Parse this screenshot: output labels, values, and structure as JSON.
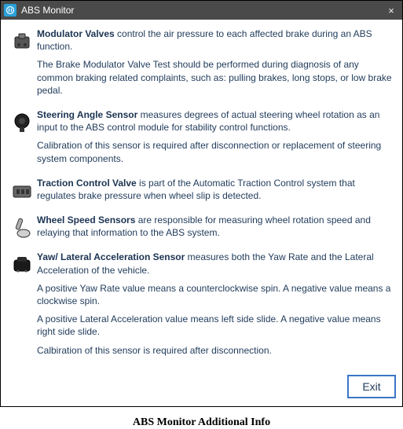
{
  "window": {
    "title": "ABS Monitor",
    "close_label": "×"
  },
  "sections": [
    {
      "title": "Modulator Valves",
      "lead": " control the air pressure to each affected brake during an ABS function.",
      "paras": [
        "The Brake Modulator Valve Test should be performed during diagnosis of any common braking related complaints, such as: pulling brakes, long stops, or low brake pedal."
      ]
    },
    {
      "title": "Steering Angle Sensor",
      "lead": " measures degrees of actual steering wheel rotation as an input to the ABS control module for stability control functions.",
      "paras": [
        "Calibration of this sensor is required after disconnection or replacement of steering system components."
      ]
    },
    {
      "title": "Traction Control Valve",
      "lead": " is part of the Automatic Traction Control system that regulates brake pressure when wheel slip is detected.",
      "paras": []
    },
    {
      "title": "Wheel Speed Sensors",
      "lead": " are responsible for measuring wheel rotation speed and relaying that information to the ABS system.",
      "paras": []
    },
    {
      "title": "Yaw/ Lateral Acceleration Sensor",
      "lead": " measures both the Yaw Rate and the Lateral Acceleration of the vehicle.",
      "paras": [
        "A positive Yaw Rate value means a counterclockwise spin. A negative value means a clockwise spin.",
        "A positive Lateral Acceleration value means left side slide. A negative value means right side slide.",
        "Calbiration of this sensor is required after disconnection."
      ]
    }
  ],
  "buttons": {
    "exit": "Exit"
  },
  "caption": "ABS Monitor Additional Info"
}
